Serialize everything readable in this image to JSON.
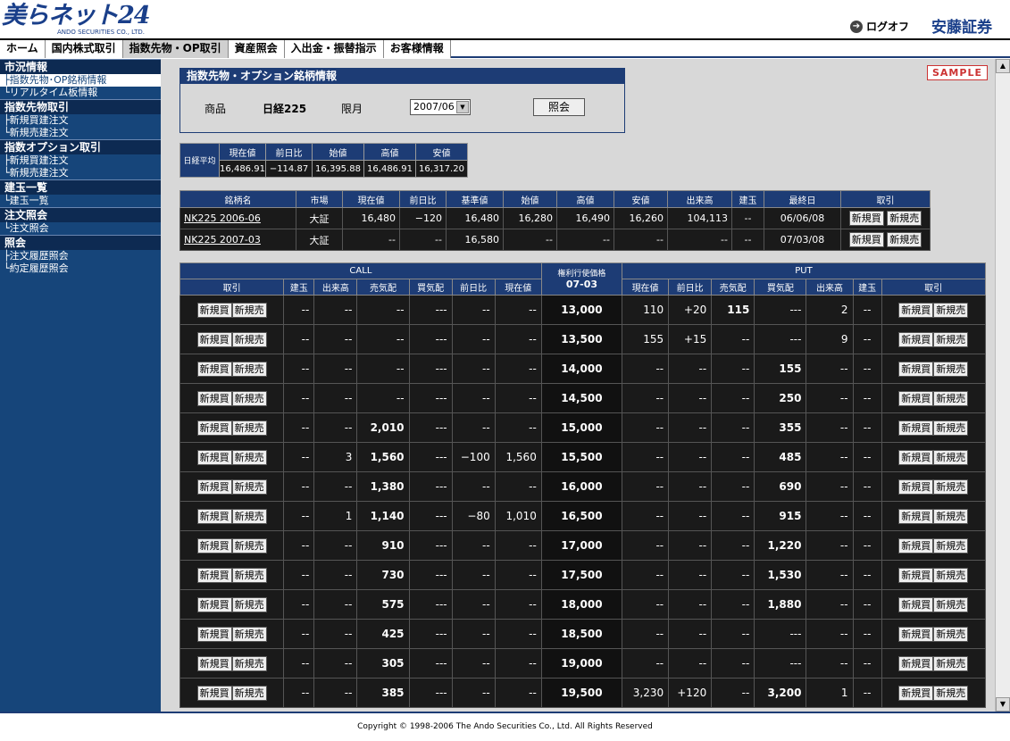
{
  "header": {
    "logo_main": "美らネット24",
    "logo_sub": "ANDO SECURITIES CO., LTD.",
    "logout_label": "ログオフ",
    "brand": "安藤証券"
  },
  "nav": {
    "tabs": [
      {
        "label": "ホーム",
        "active": false
      },
      {
        "label": "国内株式取引",
        "active": false
      },
      {
        "label": "指数先物・OP取引",
        "active": true
      },
      {
        "label": "資産照会",
        "active": false
      },
      {
        "label": "入出金・振替指示",
        "active": false
      },
      {
        "label": "お客様情報",
        "active": false
      }
    ]
  },
  "sidebar": {
    "groups": [
      {
        "title": "市況情報",
        "items": [
          {
            "label": "├指数先物･OP銘柄情報",
            "active": true
          },
          {
            "label": "└リアルタイム板情報",
            "active": false
          }
        ]
      },
      {
        "title": "指数先物取引",
        "items": [
          {
            "label": "├新規買建注文",
            "active": false
          },
          {
            "label": "└新規売建注文",
            "active": false
          }
        ]
      },
      {
        "title": "指数オプション取引",
        "items": [
          {
            "label": "├新規買建注文",
            "active": false
          },
          {
            "label": "└新規売建注文",
            "active": false
          }
        ]
      },
      {
        "title": "建玉一覧",
        "items": [
          {
            "label": "└建玉一覧",
            "active": false
          }
        ]
      },
      {
        "title": "注文照会",
        "items": [
          {
            "label": "└注文照会",
            "active": false
          }
        ]
      },
      {
        "title": "照会",
        "items": [
          {
            "label": "├注文履歴照会",
            "active": false
          },
          {
            "label": "└約定履歴照会",
            "active": false
          }
        ]
      }
    ]
  },
  "sample_label": "SAMPLE",
  "info": {
    "title": "指数先物・オプション銘柄情報",
    "product_label": "商品",
    "product_value": "日経225",
    "month_label": "限月",
    "month_value": "2007/06",
    "query_label": "照会"
  },
  "index": {
    "name": "日経平均",
    "headers": [
      "現在値",
      "前日比",
      "始値",
      "高値",
      "安値"
    ],
    "values": [
      "16,486.91",
      "−114.87",
      "16,395.88",
      "16,486.91",
      "16,317.20"
    ]
  },
  "futures": {
    "headers": [
      "銘柄名",
      "市場",
      "現在値",
      "前日比",
      "基準値",
      "始値",
      "高値",
      "安値",
      "出来高",
      "建玉",
      "最終日",
      "取引"
    ],
    "rows": [
      [
        "NK225 2006-06",
        "大証",
        "16,480",
        "−120",
        "16,480",
        "16,280",
        "16,490",
        "16,260",
        "104,113",
        "--",
        "06/06/08"
      ],
      [
        "NK225 2007-03",
        "大証",
        "--",
        "--",
        "16,580",
        "--",
        "--",
        "--",
        "--",
        "--",
        "07/03/08"
      ]
    ],
    "buy_label": "新規買",
    "sell_label": "新規売"
  },
  "options": {
    "call_label": "CALL",
    "put_label": "PUT",
    "strike_header_1": "権利行使価格",
    "strike_header_2": "07-03",
    "call_headers": [
      "取引",
      "建玉",
      "出来高",
      "売気配",
      "買気配",
      "前日比",
      "現在値"
    ],
    "put_headers": [
      "現在値",
      "前日比",
      "売気配",
      "買気配",
      "出来高",
      "建玉",
      "取引"
    ],
    "buy_label": "新規買",
    "sell_label": "新規売",
    "rows": [
      {
        "strike": "13,000",
        "c_oi": "--",
        "c_vol": "--",
        "c_ask": "--",
        "c_bid": "---",
        "c_chg": "--",
        "c_px": "--",
        "p_px": "110",
        "p_chg": "+20",
        "p_ask": "115",
        "p_bid": "---",
        "p_vol": "2",
        "p_oi": "--"
      },
      {
        "strike": "13,500",
        "c_oi": "--",
        "c_vol": "--",
        "c_ask": "--",
        "c_bid": "---",
        "c_chg": "--",
        "c_px": "--",
        "p_px": "155",
        "p_chg": "+15",
        "p_ask": "--",
        "p_bid": "---",
        "p_vol": "9",
        "p_oi": "--"
      },
      {
        "strike": "14,000",
        "c_oi": "--",
        "c_vol": "--",
        "c_ask": "--",
        "c_bid": "---",
        "c_chg": "--",
        "c_px": "--",
        "p_px": "--",
        "p_chg": "--",
        "p_ask": "--",
        "p_bid": "155",
        "p_vol": "--",
        "p_oi": "--"
      },
      {
        "strike": "14,500",
        "c_oi": "--",
        "c_vol": "--",
        "c_ask": "--",
        "c_bid": "---",
        "c_chg": "--",
        "c_px": "--",
        "p_px": "--",
        "p_chg": "--",
        "p_ask": "--",
        "p_bid": "250",
        "p_vol": "--",
        "p_oi": "--"
      },
      {
        "strike": "15,000",
        "c_oi": "--",
        "c_vol": "--",
        "c_ask": "2,010",
        "c_bid": "---",
        "c_chg": "--",
        "c_px": "--",
        "p_px": "--",
        "p_chg": "--",
        "p_ask": "--",
        "p_bid": "355",
        "p_vol": "--",
        "p_oi": "--"
      },
      {
        "strike": "15,500",
        "c_oi": "--",
        "c_vol": "3",
        "c_ask": "1,560",
        "c_bid": "---",
        "c_chg": "−100",
        "c_px": "1,560",
        "p_px": "--",
        "p_chg": "--",
        "p_ask": "--",
        "p_bid": "485",
        "p_vol": "--",
        "p_oi": "--"
      },
      {
        "strike": "16,000",
        "c_oi": "--",
        "c_vol": "--",
        "c_ask": "1,380",
        "c_bid": "---",
        "c_chg": "--",
        "c_px": "--",
        "p_px": "--",
        "p_chg": "--",
        "p_ask": "--",
        "p_bid": "690",
        "p_vol": "--",
        "p_oi": "--"
      },
      {
        "strike": "16,500",
        "c_oi": "--",
        "c_vol": "1",
        "c_ask": "1,140",
        "c_bid": "---",
        "c_chg": "−80",
        "c_px": "1,010",
        "p_px": "--",
        "p_chg": "--",
        "p_ask": "--",
        "p_bid": "915",
        "p_vol": "--",
        "p_oi": "--"
      },
      {
        "strike": "17,000",
        "c_oi": "--",
        "c_vol": "--",
        "c_ask": "910",
        "c_bid": "---",
        "c_chg": "--",
        "c_px": "--",
        "p_px": "--",
        "p_chg": "--",
        "p_ask": "--",
        "p_bid": "1,220",
        "p_vol": "--",
        "p_oi": "--"
      },
      {
        "strike": "17,500",
        "c_oi": "--",
        "c_vol": "--",
        "c_ask": "730",
        "c_bid": "---",
        "c_chg": "--",
        "c_px": "--",
        "p_px": "--",
        "p_chg": "--",
        "p_ask": "--",
        "p_bid": "1,530",
        "p_vol": "--",
        "p_oi": "--"
      },
      {
        "strike": "18,000",
        "c_oi": "--",
        "c_vol": "--",
        "c_ask": "575",
        "c_bid": "---",
        "c_chg": "--",
        "c_px": "--",
        "p_px": "--",
        "p_chg": "--",
        "p_ask": "--",
        "p_bid": "1,880",
        "p_vol": "--",
        "p_oi": "--"
      },
      {
        "strike": "18,500",
        "c_oi": "--",
        "c_vol": "--",
        "c_ask": "425",
        "c_bid": "---",
        "c_chg": "--",
        "c_px": "--",
        "p_px": "--",
        "p_chg": "--",
        "p_ask": "--",
        "p_bid": "---",
        "p_vol": "--",
        "p_oi": "--"
      },
      {
        "strike": "19,000",
        "c_oi": "--",
        "c_vol": "--",
        "c_ask": "305",
        "c_bid": "---",
        "c_chg": "--",
        "c_px": "--",
        "p_px": "--",
        "p_chg": "--",
        "p_ask": "--",
        "p_bid": "---",
        "p_vol": "--",
        "p_oi": "--"
      },
      {
        "strike": "19,500",
        "c_oi": "--",
        "c_vol": "--",
        "c_ask": "385",
        "c_bid": "---",
        "c_chg": "--",
        "c_px": "--",
        "p_px": "3,230",
        "p_chg": "+120",
        "p_ask": "--",
        "p_bid": "3,200",
        "p_vol": "1",
        "p_oi": "--"
      }
    ]
  },
  "footer": "Copyright © 1998-2006 The Ando Securities Co., Ltd. All Rights Reserved"
}
